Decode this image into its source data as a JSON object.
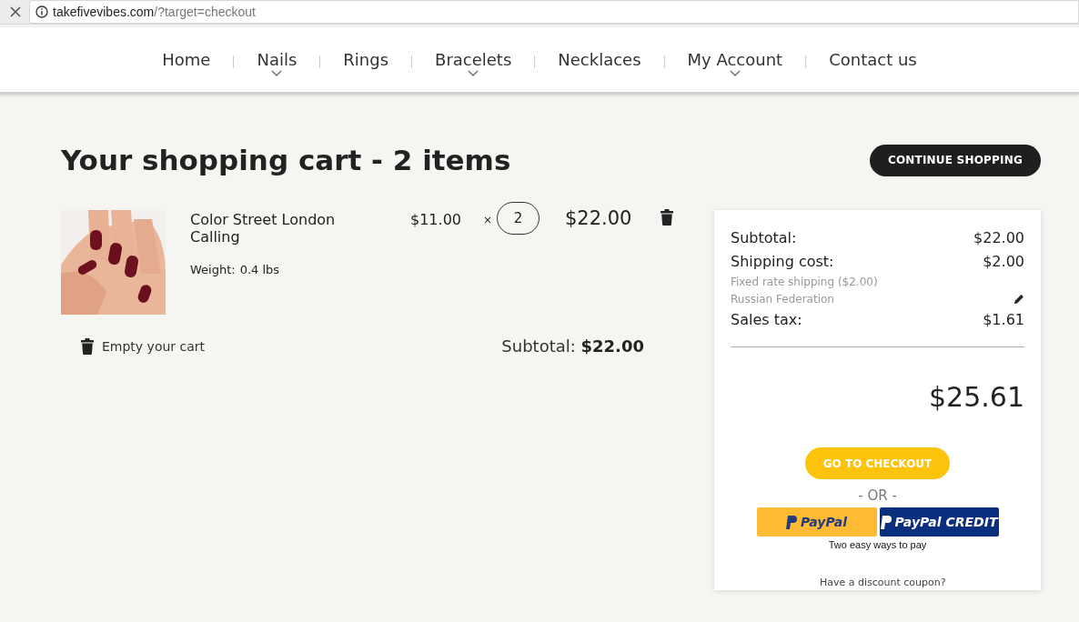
{
  "browser": {
    "url_host": "takefivevibes.com",
    "url_path": "/?target=checkout"
  },
  "nav": [
    {
      "label": "Home",
      "has_dropdown": false
    },
    {
      "label": "Nails",
      "has_dropdown": true
    },
    {
      "label": "Rings",
      "has_dropdown": false
    },
    {
      "label": "Bracelets",
      "has_dropdown": true
    },
    {
      "label": "Necklaces",
      "has_dropdown": false
    },
    {
      "label": "My Account",
      "has_dropdown": true
    },
    {
      "label": "Contact us",
      "has_dropdown": false
    }
  ],
  "cart": {
    "title": "Your shopping cart - 2 items",
    "continue_button": "CONTINUE SHOPPING",
    "items": [
      {
        "name": "Color Street London Calling",
        "weight_label": "Weight:",
        "weight": "0.4 lbs",
        "price": "$11.00",
        "times": "×",
        "quantity": "2",
        "total": "$22.00"
      }
    ],
    "empty_cart": "Empty your cart",
    "subtotal_label": "Subtotal:",
    "subtotal": "$22.00"
  },
  "summary": {
    "rows": [
      {
        "kind": "amount",
        "label": "Subtotal:",
        "value": "$22.00"
      },
      {
        "kind": "amount",
        "label": "Shipping cost:",
        "value": "$2.00"
      },
      {
        "kind": "note",
        "text": "Fixed rate shipping ($2.00)",
        "editable": false
      },
      {
        "kind": "note",
        "text": "Russian Federation",
        "editable": true
      },
      {
        "kind": "amount",
        "label": "Sales tax:",
        "value": "$1.61"
      }
    ],
    "total": "$25.61",
    "checkout_button": "GO TO CHECKOUT",
    "or": "- OR -",
    "paypal": "PayPal",
    "paypal_credit": "PayPal CREDIT",
    "paypal_note": "Two easy ways to pay"
  },
  "coupon": "Have a discount coupon?"
}
